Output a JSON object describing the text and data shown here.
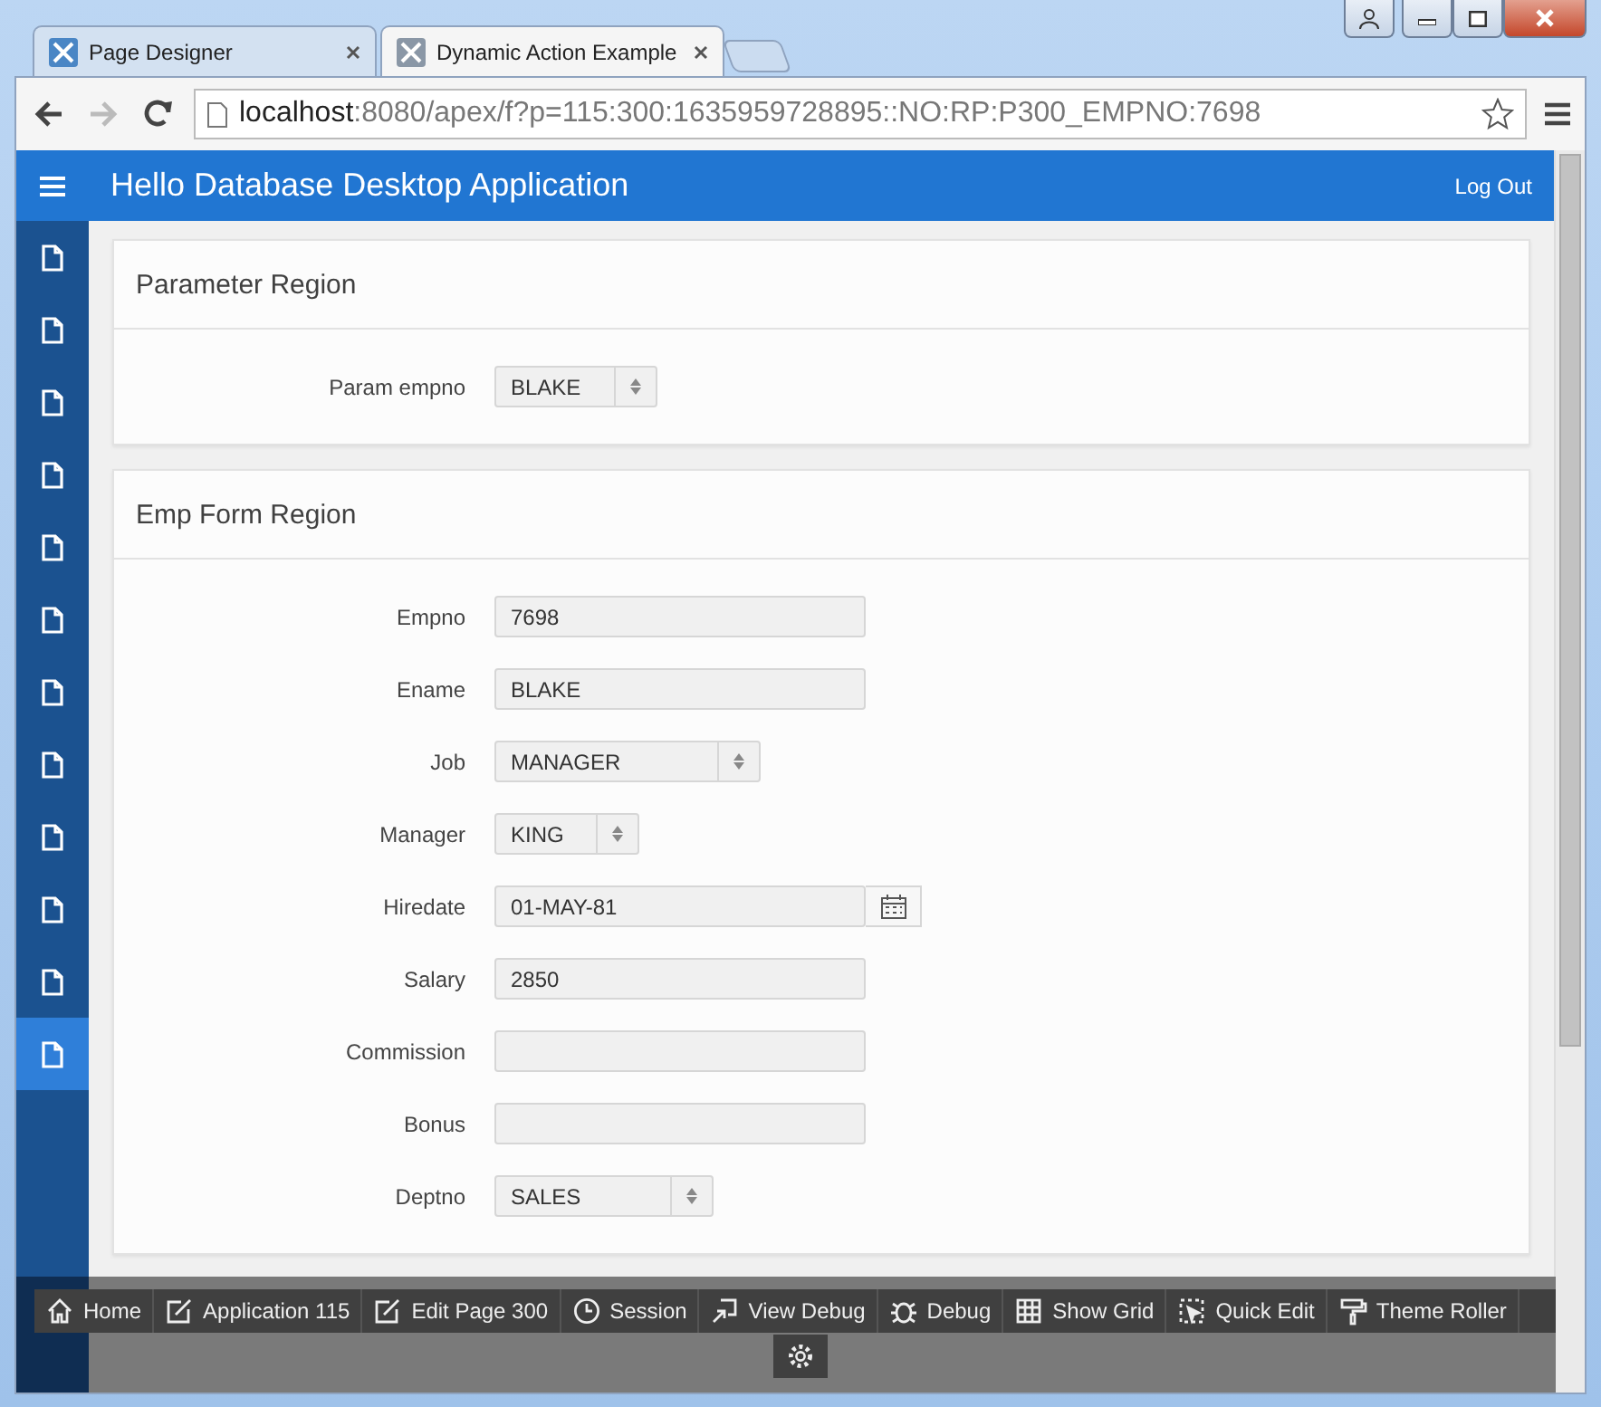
{
  "browser": {
    "tabs": [
      {
        "label": "Page Designer",
        "selected": false
      },
      {
        "label": "Dynamic Action Example",
        "selected": true
      }
    ],
    "url_host": "localhost",
    "url_rest": ":8080/apex/f?p=115:300:1635959728895::NO:RP:P300_EMPNO:7698"
  },
  "header": {
    "title": "Hello Database Desktop Application",
    "logout": "Log Out"
  },
  "sidebar": {
    "items": [
      {
        "selected": false
      },
      {
        "selected": false
      },
      {
        "selected": false
      },
      {
        "selected": false
      },
      {
        "selected": false
      },
      {
        "selected": false
      },
      {
        "selected": false
      },
      {
        "selected": false
      },
      {
        "selected": false
      },
      {
        "selected": false
      },
      {
        "selected": false
      },
      {
        "selected": true
      }
    ]
  },
  "regions": [
    {
      "title": "Parameter Region",
      "fields": [
        {
          "label": "Param empno",
          "kind": "select",
          "value": "BLAKE"
        }
      ]
    },
    {
      "title": "Emp Form Region",
      "fields": [
        {
          "label": "Empno",
          "kind": "text",
          "value": "7698"
        },
        {
          "label": "Ename",
          "kind": "text",
          "value": "BLAKE"
        },
        {
          "label": "Job",
          "kind": "select",
          "value": "MANAGER"
        },
        {
          "label": "Manager",
          "kind": "select",
          "value": "KING"
        },
        {
          "label": "Hiredate",
          "kind": "date",
          "value": "01-MAY-81"
        },
        {
          "label": "Salary",
          "kind": "text",
          "value": "2850"
        },
        {
          "label": "Commission",
          "kind": "text"
        },
        {
          "label": "Bonus",
          "kind": "text"
        },
        {
          "label": "Deptno",
          "kind": "select",
          "value": "SALES"
        }
      ]
    }
  ],
  "dev_toolbar": [
    {
      "label": "Home"
    },
    {
      "label": "Application 115"
    },
    {
      "label": "Edit Page 300"
    },
    {
      "label": "Session"
    },
    {
      "label": "View Debug"
    },
    {
      "label": "Debug"
    },
    {
      "label": "Show Grid"
    },
    {
      "label": "Quick Edit"
    },
    {
      "label": "Theme Roller"
    }
  ]
}
